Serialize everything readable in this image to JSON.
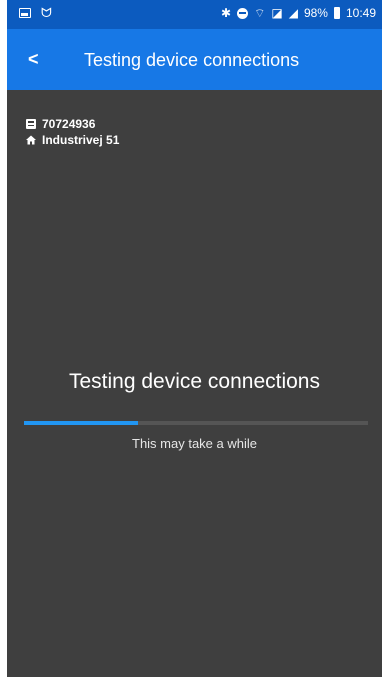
{
  "status_bar": {
    "battery": "98%",
    "time": "10:49",
    "icons": [
      "image-icon",
      "signal-icon",
      "bluetooth-icon",
      "do-not-disturb-icon",
      "wifi-icon",
      "no-sim-icon",
      "mobile-signal-icon",
      "battery-icon"
    ]
  },
  "app_bar": {
    "back_label": "<",
    "title": "Testing device connections"
  },
  "info": {
    "device_id": "70724936",
    "address": "Industrivej 51"
  },
  "main": {
    "title": "Testing device connections",
    "progress_fraction": 0.33,
    "subtitle": "This may take a while"
  },
  "colors": {
    "status_bar": "#0c5bbf",
    "app_bar": "#1778e6",
    "background": "#3f3f3f",
    "progress_fill": "#2196f3",
    "progress_track": "#555555"
  }
}
